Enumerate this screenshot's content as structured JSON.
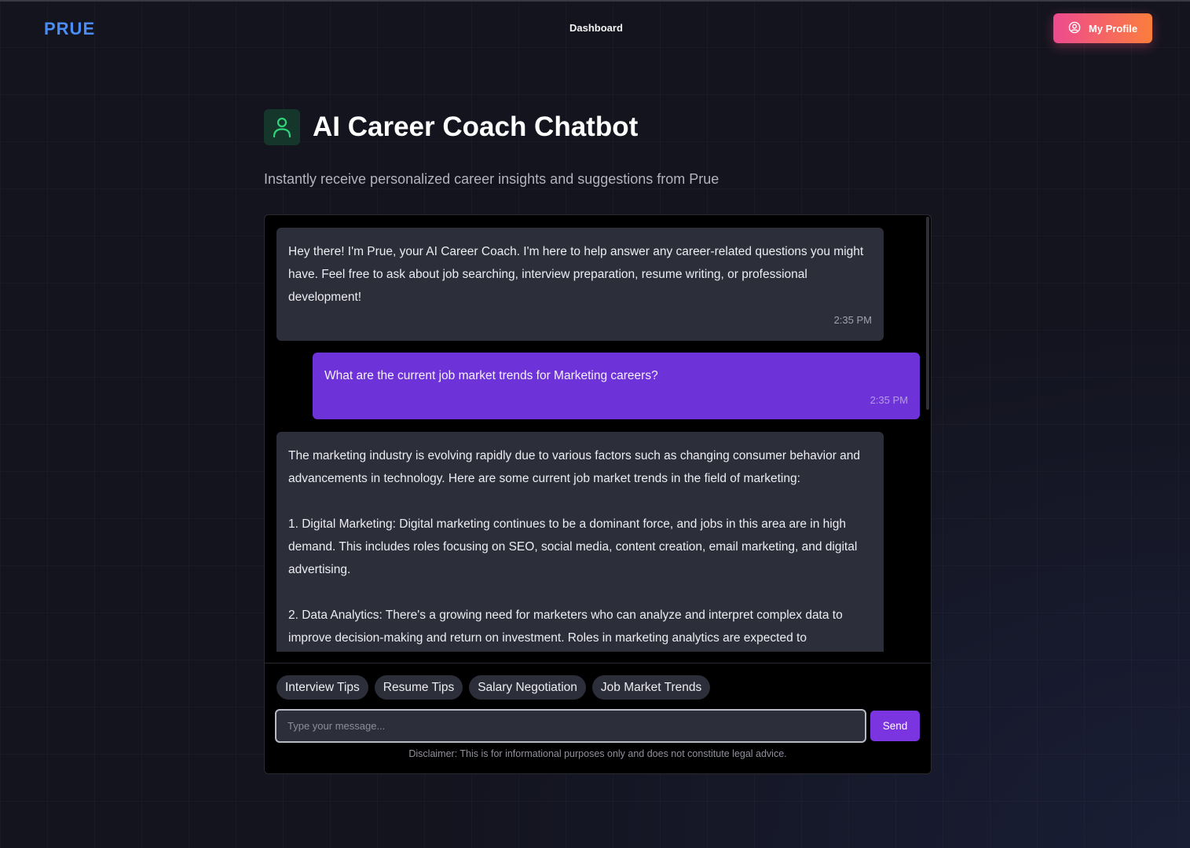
{
  "header": {
    "logo": "PRUE",
    "nav_dashboard": "Dashboard",
    "profile_label": "My Profile"
  },
  "page": {
    "title": "AI Career Coach Chatbot",
    "subtitle": "Instantly receive personalized career insights and suggestions from Prue"
  },
  "messages": [
    {
      "sender": "bot",
      "text": "Hey there! I'm Prue, your AI Career Coach. I'm here to help answer any career-related questions you might have. Feel free to ask about job searching, interview preparation, resume writing, or professional development!",
      "time": "2:35 PM"
    },
    {
      "sender": "user",
      "text": "What are the current job market trends for Marketing careers?",
      "time": "2:35 PM"
    },
    {
      "sender": "bot",
      "text": "The marketing industry is evolving rapidly due to various factors such as changing consumer behavior and advancements in technology. Here are some current job market trends in the field of marketing:\n\n1. Digital Marketing: Digital marketing continues to be a dominant force, and jobs in this area are in high demand. This includes roles focusing on SEO, social media, content creation, email marketing, and digital advertising.\n\n2. Data Analytics: There's a growing need for marketers who can analyze and interpret complex data to improve decision-making and return on investment. Roles in marketing analytics are expected to"
    }
  ],
  "quick_replies": [
    "Interview Tips",
    "Resume Tips",
    "Salary Negotiation",
    "Job Market Trends"
  ],
  "composer": {
    "placeholder": "Type your message...",
    "send_label": "Send",
    "disclaimer": "Disclaimer: This is for informational purposes only and does not constitute legal advice."
  },
  "colors": {
    "logo": "#4a8df6",
    "profile_gradient_start": "#ee4a8f",
    "profile_gradient_end": "#fb7e3c",
    "user_bubble": "#6d32d8",
    "bot_bubble": "#2c2e39",
    "send_button": "#7a35e0",
    "title_icon": "#2fd37a"
  },
  "icons": {
    "profile": "user-circle-icon",
    "title": "user-icon"
  }
}
